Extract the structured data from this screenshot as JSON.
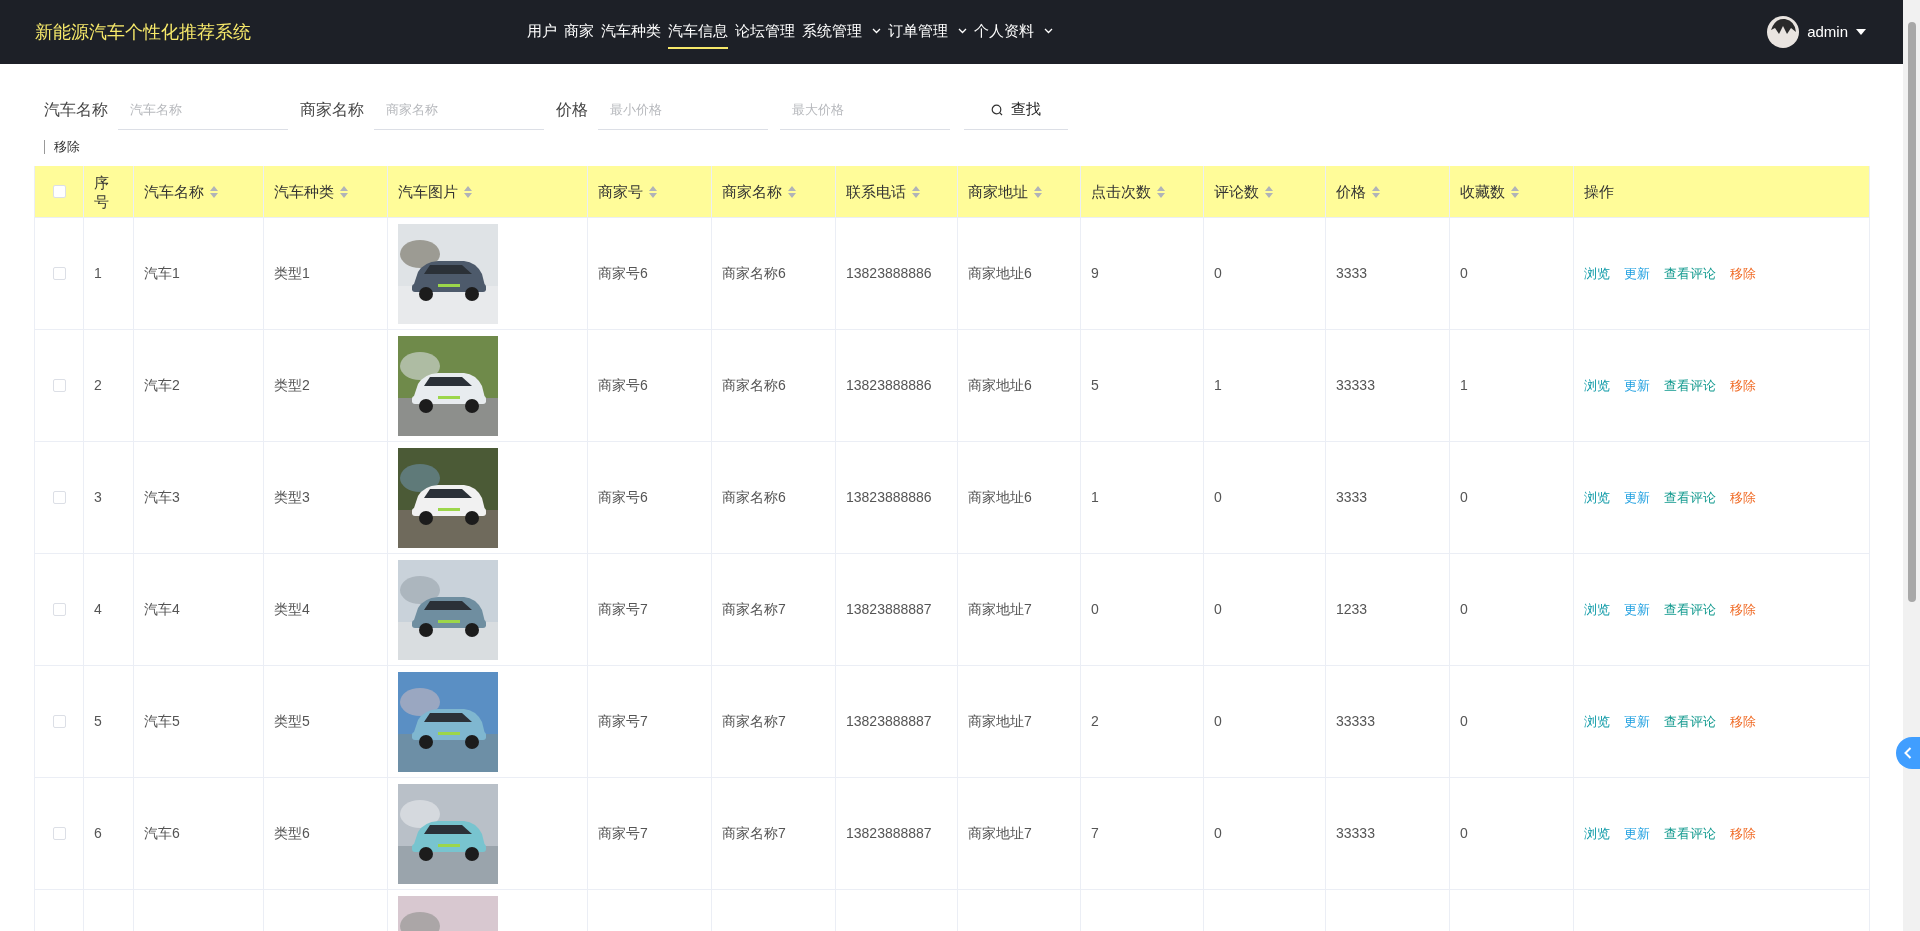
{
  "header": {
    "title": "新能源汽车个性化推荐系统",
    "nav": [
      {
        "label": "用户",
        "selected": false,
        "has_menu": false
      },
      {
        "label": "商家",
        "selected": false,
        "has_menu": false
      },
      {
        "label": "汽车种类",
        "selected": false,
        "has_menu": false
      },
      {
        "label": "汽车信息",
        "selected": true,
        "has_menu": false
      },
      {
        "label": "论坛管理",
        "selected": false,
        "has_menu": false
      },
      {
        "label": "系统管理",
        "selected": false,
        "has_menu": true
      },
      {
        "label": "订单管理",
        "selected": false,
        "has_menu": true
      },
      {
        "label": "个人资料",
        "selected": false,
        "has_menu": true
      }
    ],
    "user": {
      "name": "admin"
    }
  },
  "search": {
    "fields": [
      {
        "label": "汽车名称",
        "placeholder": "汽车名称"
      },
      {
        "label": "商家名称",
        "placeholder": "商家名称"
      },
      {
        "label": "价格",
        "placeholder": "最小价格"
      },
      {
        "placeholder": "最大价格"
      }
    ],
    "button": "查找",
    "remove": "移除"
  },
  "table": {
    "select_all": {
      "checked": false
    },
    "columns": [
      {
        "label": "序号",
        "sortable": false
      },
      {
        "label": "汽车名称",
        "sortable": true
      },
      {
        "label": "汽车种类",
        "sortable": true
      },
      {
        "label": "汽车图片",
        "sortable": true
      },
      {
        "label": "商家号",
        "sortable": true
      },
      {
        "label": "商家名称",
        "sortable": true
      },
      {
        "label": "联系电话",
        "sortable": true
      },
      {
        "label": "商家地址",
        "sortable": true
      },
      {
        "label": "点击次数",
        "sortable": true
      },
      {
        "label": "评论数",
        "sortable": true
      },
      {
        "label": "价格",
        "sortable": true
      },
      {
        "label": "收藏数",
        "sortable": true
      },
      {
        "label": "操作",
        "sortable": false
      }
    ],
    "rows": [
      {
        "checked": false,
        "cells": [
          "1",
          "汽车1",
          "类型1",
          {
            "kind": "picture"
          },
          "商家号6",
          "商家名称6",
          "13823888886",
          "商家地址6",
          "9",
          "0",
          "3333",
          "0"
        ],
        "actions": [
          "浏览",
          "更新",
          "查看评论",
          "移除"
        ]
      },
      {
        "checked": false,
        "cells": [
          "2",
          "汽车2",
          "类型2",
          {
            "kind": "picture"
          },
          "商家号6",
          "商家名称6",
          "13823888886",
          "商家地址6",
          "5",
          "1",
          "33333",
          "1"
        ],
        "actions": [
          "浏览",
          "更新",
          "查看评论",
          "移除"
        ]
      },
      {
        "checked": false,
        "cells": [
          "3",
          "汽车3",
          "类型3",
          {
            "kind": "picture"
          },
          "商家号6",
          "商家名称6",
          "13823888886",
          "商家地址6",
          "1",
          "0",
          "3333",
          "0"
        ],
        "actions": [
          "浏览",
          "更新",
          "查看评论",
          "移除"
        ]
      },
      {
        "checked": false,
        "cells": [
          "4",
          "汽车4",
          "类型4",
          {
            "kind": "picture"
          },
          "商家号7",
          "商家名称7",
          "13823888887",
          "商家地址7",
          "0",
          "0",
          "1233",
          "0"
        ],
        "actions": [
          "浏览",
          "更新",
          "查看评论",
          "移除"
        ]
      },
      {
        "checked": false,
        "cells": [
          "5",
          "汽车5",
          "类型5",
          {
            "kind": "picture"
          },
          "商家号7",
          "商家名称7",
          "13823888887",
          "商家地址7",
          "2",
          "0",
          "33333",
          "0"
        ],
        "actions": [
          "浏览",
          "更新",
          "查看评论",
          "移除"
        ]
      },
      {
        "checked": false,
        "cells": [
          "6",
          "汽车6",
          "类型6",
          {
            "kind": "picture"
          },
          "商家号7",
          "商家名称7",
          "13823888887",
          "商家地址7",
          "7",
          "0",
          "33333",
          "0"
        ],
        "actions": [
          "浏览",
          "更新",
          "查看评论",
          "移除"
        ]
      },
      {
        "cells": [
          {
            "kind": "picture"
          }
        ]
      }
    ]
  }
}
